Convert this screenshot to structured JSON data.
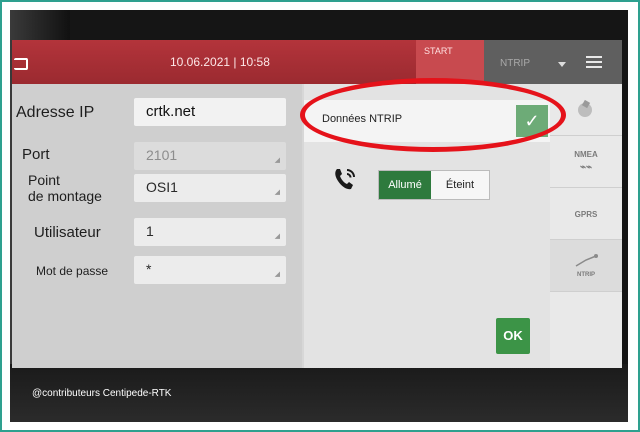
{
  "header": {
    "datetime": "10.06.2021 | 10:58",
    "start_label": "START",
    "profile_label": "NTRIP"
  },
  "form": {
    "ip": {
      "label": "Adresse IP",
      "value": "crtk.net"
    },
    "port": {
      "label": "Port",
      "value": "2101"
    },
    "mount": {
      "label_line1": "Point",
      "label_line2": "de montage",
      "value": "OSI1"
    },
    "user": {
      "label": "Utilisateur",
      "value": "1"
    },
    "password": {
      "label": "Mot de passe",
      "value": "*"
    }
  },
  "ntrip": {
    "label": "Données NTRIP",
    "enabled": true,
    "toggle_on": "Allumé",
    "toggle_off": "Éteint",
    "toggle_state": "Allumé"
  },
  "ok_label": "OK",
  "side_tabs": [
    {
      "label": "",
      "icon": "satellite-icon"
    },
    {
      "label": "NMEA",
      "icon": "nmea-icon"
    },
    {
      "label": "GPRS",
      "icon": ""
    },
    {
      "label": "NTRIP",
      "icon": "ntrip-icon"
    }
  ],
  "watermark": "@contributeurs Centipede-RTK",
  "colors": {
    "header_red": "#a52e35",
    "accent_green": "#2e7a3d",
    "annotation_red": "#e5121a"
  }
}
